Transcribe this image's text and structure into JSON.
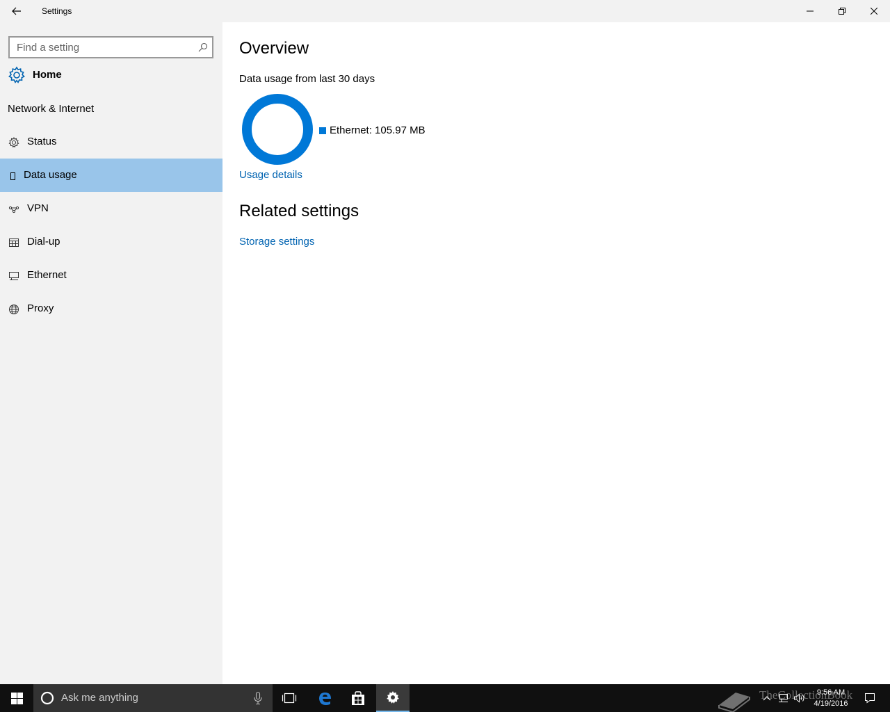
{
  "window": {
    "title": "Settings"
  },
  "sidebar": {
    "search_placeholder": "Find a setting",
    "home_label": "Home",
    "section_title": "Network & Internet",
    "items": [
      {
        "label": "Status",
        "icon": "status-gear-icon",
        "selected": false
      },
      {
        "label": "Data usage",
        "icon": "data-usage-icon",
        "selected": true
      },
      {
        "label": "VPN",
        "icon": "vpn-icon",
        "selected": false
      },
      {
        "label": "Dial-up",
        "icon": "dial-up-icon",
        "selected": false
      },
      {
        "label": "Ethernet",
        "icon": "ethernet-icon",
        "selected": false
      },
      {
        "label": "Proxy",
        "icon": "globe-icon",
        "selected": false
      }
    ]
  },
  "main": {
    "overview_heading": "Overview",
    "usage_subtitle": "Data usage from last 30 days",
    "usage_chart": {
      "series": [
        {
          "name": "Ethernet",
          "value_mb": 105.97,
          "share": 1.0,
          "color": "#0078d7"
        }
      ]
    },
    "legend_text": "Ethernet: 105.97 MB",
    "usage_details_link": "Usage details",
    "related_heading": "Related settings",
    "storage_settings_link": "Storage settings"
  },
  "taskbar": {
    "search_placeholder": "Ask me anything",
    "time": "9:56 AM",
    "date": "4/19/2016",
    "watermark": "TheCollectionBook"
  },
  "colors": {
    "accent": "#0078d7",
    "link": "#0063b1",
    "selected_bg": "#99c5ea",
    "sidebar_bg": "#f2f2f2",
    "taskbar_bg": "#101010"
  }
}
